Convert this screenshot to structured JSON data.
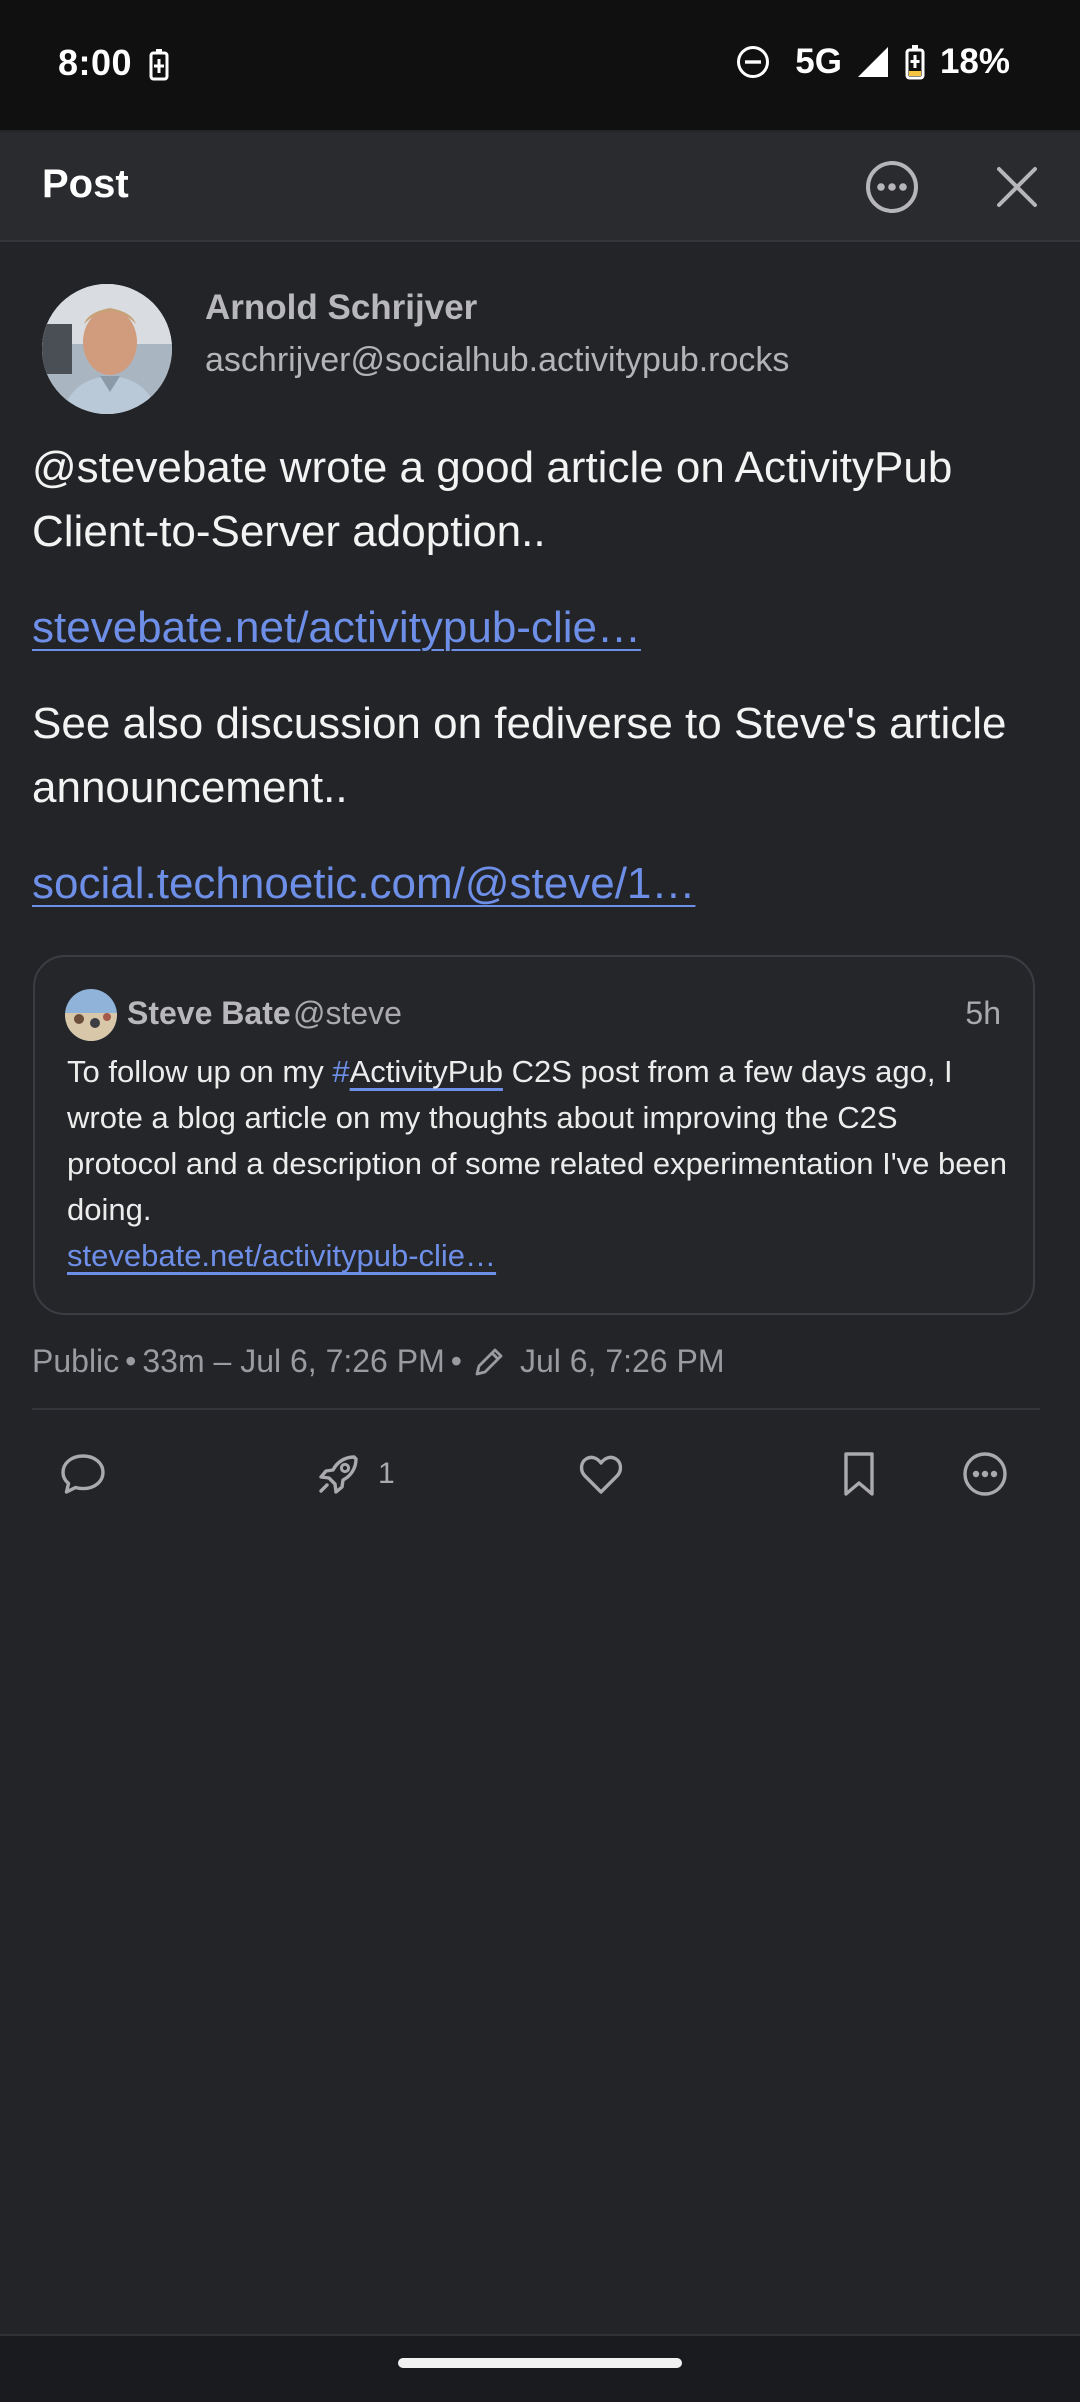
{
  "status_bar": {
    "time": "8:00",
    "network": "5G",
    "battery": "18%",
    "icons": [
      "battery-charging-icon",
      "do-not-disturb-icon",
      "signal-icon",
      "battery-icon"
    ]
  },
  "header": {
    "title": "Post",
    "more_icon": "more-horizontal-circle-icon",
    "close_icon": "close-icon"
  },
  "post": {
    "author_name": "Arnold Schrijver",
    "author_handle": "aschrijver@socialhub.activitypub.rocks",
    "paragraph1": "@stevebate wrote a good article on ActivityPub Client-to-Server adoption..",
    "link1": "stevebate.net/activitypub-clie…",
    "paragraph2": "See also discussion on fediverse to Steve's article announcement..",
    "link2": "social.technoetic.com/@steve/1…"
  },
  "quote": {
    "name": "Steve Bate",
    "handle": "@steve",
    "time": "5h",
    "text_before": "To follow up on my ",
    "hashtag_symbol": "#",
    "hashtag_word": "ActivityPub",
    "text_after": " C2S post from a few days ago, I wrote a blog article on my thoughts about improving the C2S protocol and a description of some related experimentation I've been doing.",
    "link": "stevebate.net/activitypub-clie…"
  },
  "meta": {
    "visibility": "Public",
    "sep1": "•",
    "relative_time": "33m – Jul 6, 7:26 PM",
    "sep2": "•",
    "edited_time": "Jul 6, 7:26 PM"
  },
  "actions": {
    "boost_count": "1",
    "icons": [
      "reply-icon",
      "boost-icon",
      "like-icon",
      "bookmark-icon",
      "more-icon"
    ]
  },
  "colors": {
    "background": "#232427",
    "link": "#6E8FE8",
    "muted": "#9A9BA0"
  }
}
